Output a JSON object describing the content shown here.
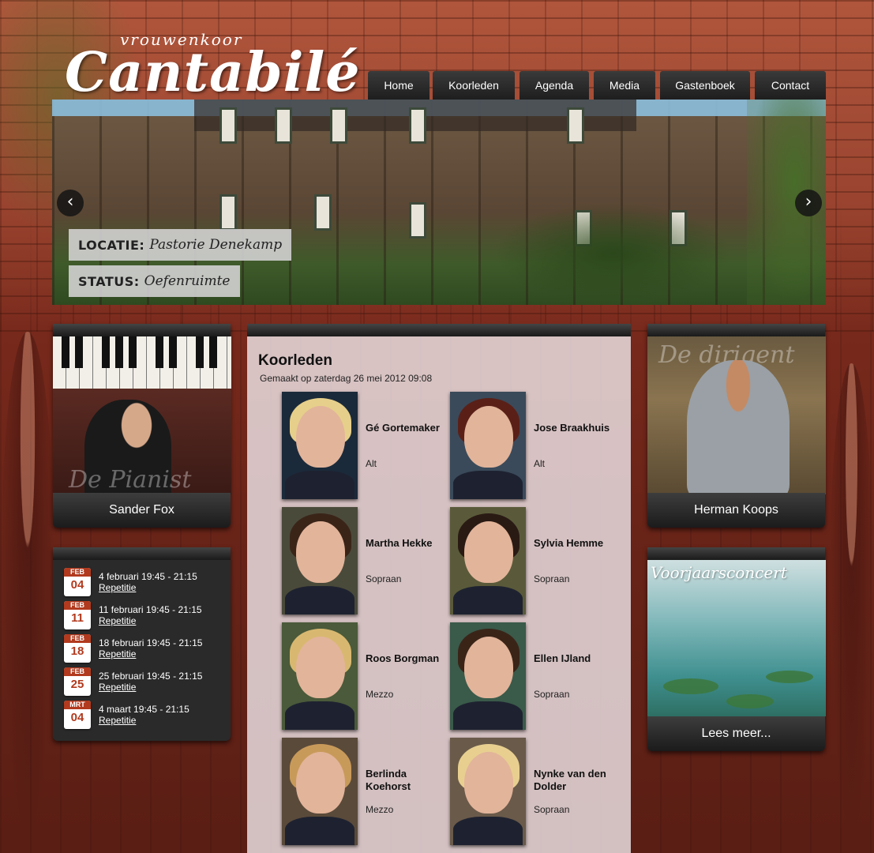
{
  "logo": {
    "sub": "vrouwenkoor",
    "main": "Cantabilé"
  },
  "nav": [
    {
      "label": "Home"
    },
    {
      "label": "Koorleden"
    },
    {
      "label": "Agenda"
    },
    {
      "label": "Media"
    },
    {
      "label": "Gastenboek"
    },
    {
      "label": "Contact"
    }
  ],
  "slider": {
    "captions": [
      {
        "key": "LOCATIE:",
        "value": "Pastorie Denekamp"
      },
      {
        "key": "STATUS:",
        "value": "Oefenruimte"
      }
    ],
    "prev_glyph": "‹",
    "next_glyph": "›"
  },
  "pianist": {
    "watermark": "De Pianist",
    "name": "Sander Fox"
  },
  "conductor": {
    "watermark": "De dirigent",
    "name": "Herman Koops"
  },
  "agenda": [
    {
      "month": "FEB",
      "day": "04",
      "date": "4 februari 19:45 - 21:15",
      "link": "Repetitie"
    },
    {
      "month": "FEB",
      "day": "11",
      "date": "11 februari 19:45 - 21:15",
      "link": "Repetitie"
    },
    {
      "month": "FEB",
      "day": "18",
      "date": "18 februari 19:45 - 21:15",
      "link": "Repetitie"
    },
    {
      "month": "FEB",
      "day": "25",
      "date": "25 februari 19:45 - 21:15",
      "link": "Repetitie"
    },
    {
      "month": "MRT",
      "day": "04",
      "date": "4 maart 19:45 - 21:15",
      "link": "Repetitie"
    }
  ],
  "concert": {
    "poster_title": "Voorjaarsconcert",
    "more": "Lees meer..."
  },
  "main": {
    "title": "Koorleden",
    "meta": "Gemaakt op zaterdag 26 mei 2012 09:08",
    "members": [
      {
        "name": "Gé Gortemaker",
        "voice": "Alt",
        "hair": "#e6cf8a"
      },
      {
        "name": "Jose Braakhuis",
        "voice": "Alt",
        "hair": "#5a2018"
      },
      {
        "name": "Martha Hekke",
        "voice": "Sopraan",
        "hair": "#3a2418"
      },
      {
        "name": "Sylvia Hemme",
        "voice": "Sopraan",
        "hair": "#2a1a14"
      },
      {
        "name": "Roos Borgman",
        "voice": "Mezzo",
        "hair": "#d8b870"
      },
      {
        "name": "Ellen IJland",
        "voice": "Sopraan",
        "hair": "#3a2418"
      },
      {
        "name": "Berlinda Koehorst",
        "voice": "Mezzo",
        "hair": "#c89a5a"
      },
      {
        "name": "Nynke van den Dolder",
        "voice": "Sopraan",
        "hair": "#e8cf90"
      }
    ]
  }
}
